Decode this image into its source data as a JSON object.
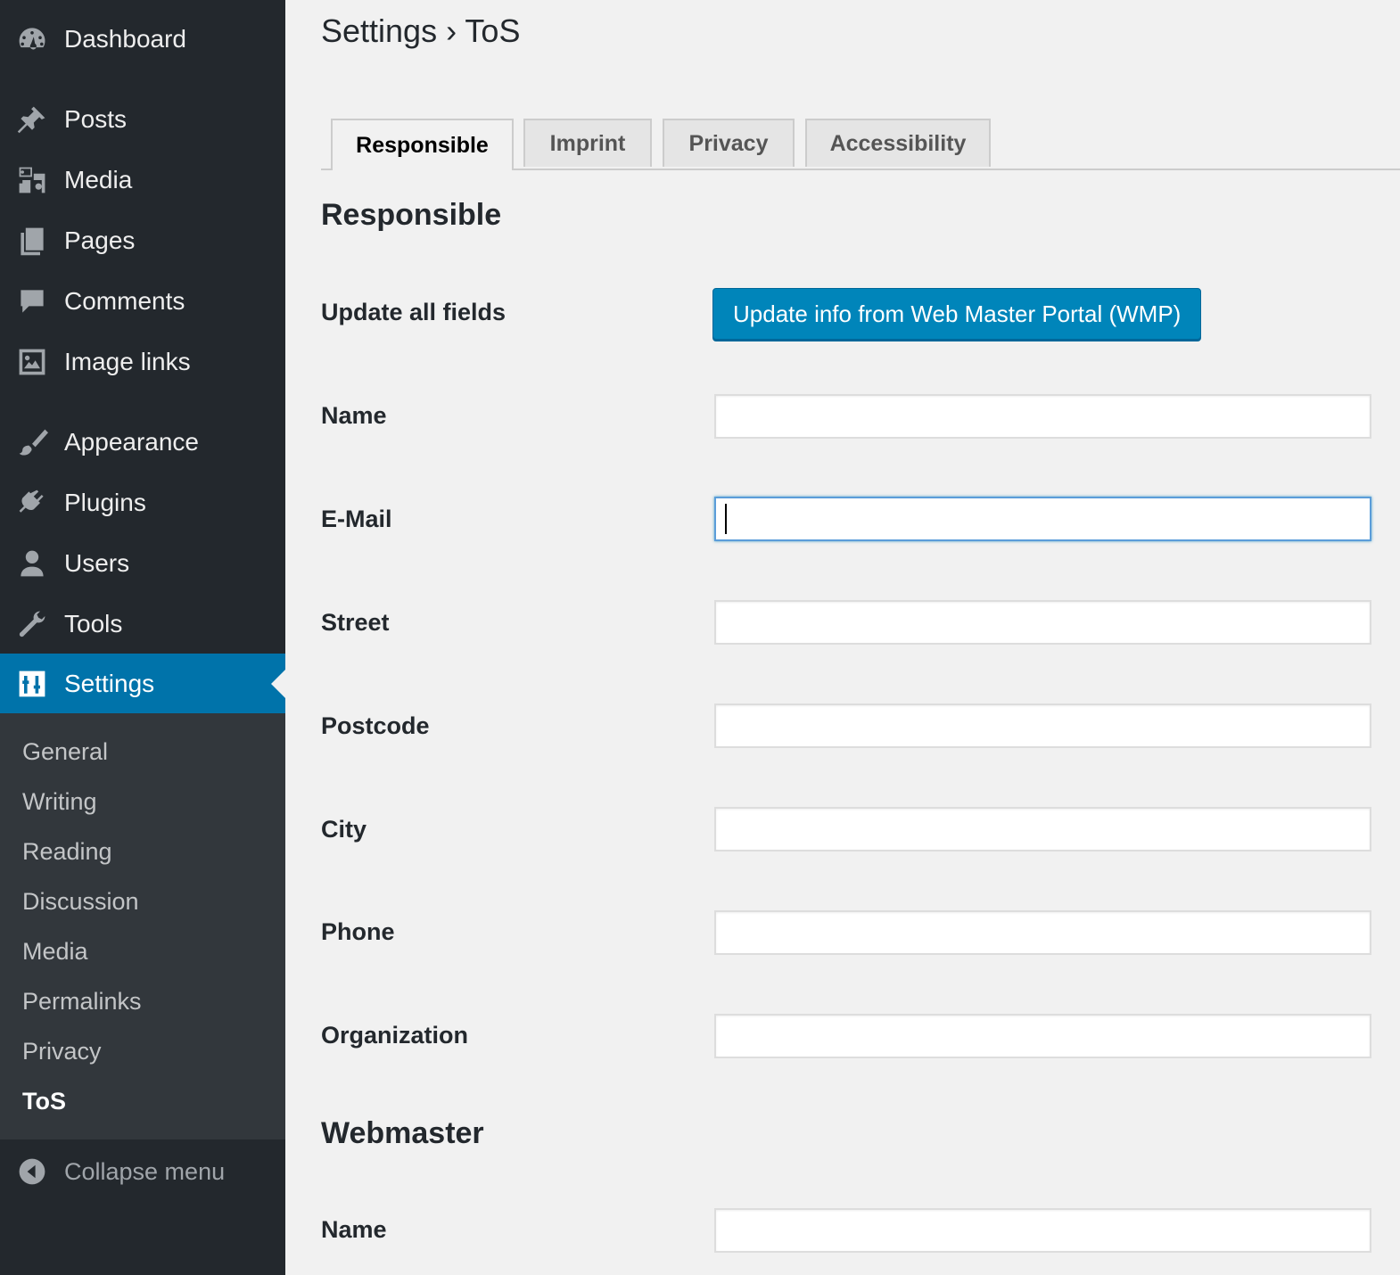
{
  "sidebar": {
    "items": [
      {
        "label": "Dashboard",
        "icon": "dashboard-icon"
      },
      {
        "label": "Posts",
        "icon": "pin-icon"
      },
      {
        "label": "Media",
        "icon": "media-icon"
      },
      {
        "label": "Pages",
        "icon": "pages-icon"
      },
      {
        "label": "Comments",
        "icon": "comment-icon"
      },
      {
        "label": "Image links",
        "icon": "image-icon"
      },
      {
        "label": "Appearance",
        "icon": "paintbrush-icon"
      },
      {
        "label": "Plugins",
        "icon": "plugin-icon"
      },
      {
        "label": "Users",
        "icon": "user-icon"
      },
      {
        "label": "Tools",
        "icon": "wrench-icon"
      },
      {
        "label": "Settings",
        "icon": "settings-icon"
      }
    ],
    "submenu": [
      "General",
      "Writing",
      "Reading",
      "Discussion",
      "Media",
      "Permalinks",
      "Privacy",
      "ToS"
    ],
    "collapse_label": "Collapse menu",
    "active_color": "#0073aa"
  },
  "main": {
    "title": "Settings › ToS",
    "tabs": [
      "Responsible",
      "Imprint",
      "Privacy",
      "Accessibility"
    ],
    "section_responsible": "Responsible",
    "update_label": "Update all fields",
    "update_button": "Update info from Web Master Portal (WMP)",
    "fields": [
      "Name",
      "E-Mail",
      "Street",
      "Postcode",
      "City",
      "Phone",
      "Organization"
    ],
    "section_webmaster": "Webmaster",
    "webmaster_fields": [
      "Name"
    ],
    "button_color": "#0085ba"
  }
}
